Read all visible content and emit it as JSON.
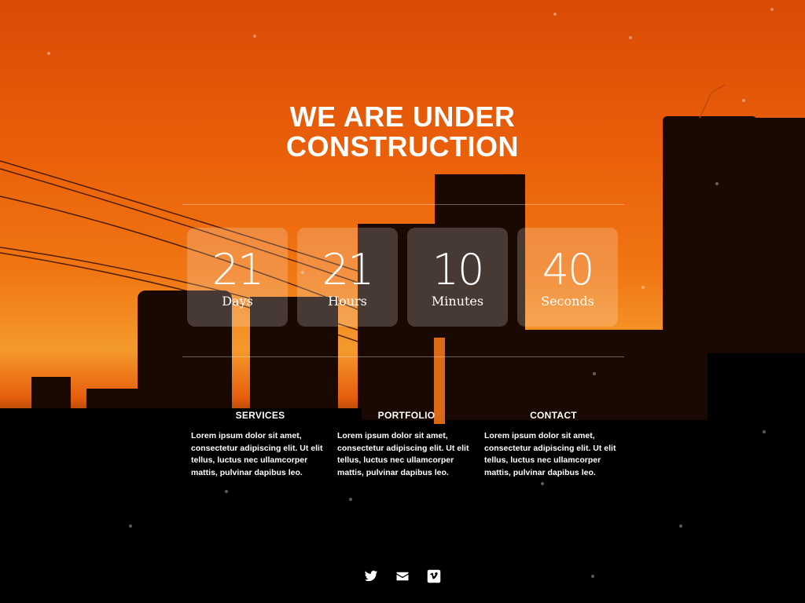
{
  "headline": {
    "line1": "WE ARE UNDER",
    "line2": "CONSTRUCTION"
  },
  "countdown": [
    {
      "value": "21",
      "unit": "Days"
    },
    {
      "value": "21",
      "unit": "Hours"
    },
    {
      "value": "10",
      "unit": "Minutes"
    },
    {
      "value": "40",
      "unit": "Seconds"
    }
  ],
  "sections": [
    {
      "title": "SERVICES",
      "text": "Lorem ipsum dolor sit amet, consectetur adipiscing elit. Ut elit tellus, luctus nec ullamcorper mattis, pulvinar dapibus leo."
    },
    {
      "title": "PORTFOLIO",
      "text": "Lorem ipsum dolor sit amet, consectetur adipiscing elit. Ut elit tellus, luctus nec ullamcorper mattis, pulvinar dapibus leo."
    },
    {
      "title": "CONTACT",
      "text": "Lorem ipsum dolor sit amet, consectetur adipiscing elit. Ut elit tellus, luctus nec ullamcorper mattis, pulvinar dapibus leo."
    }
  ],
  "social_icons": [
    "twitter-icon",
    "envelope-icon",
    "vimeo-icon"
  ]
}
